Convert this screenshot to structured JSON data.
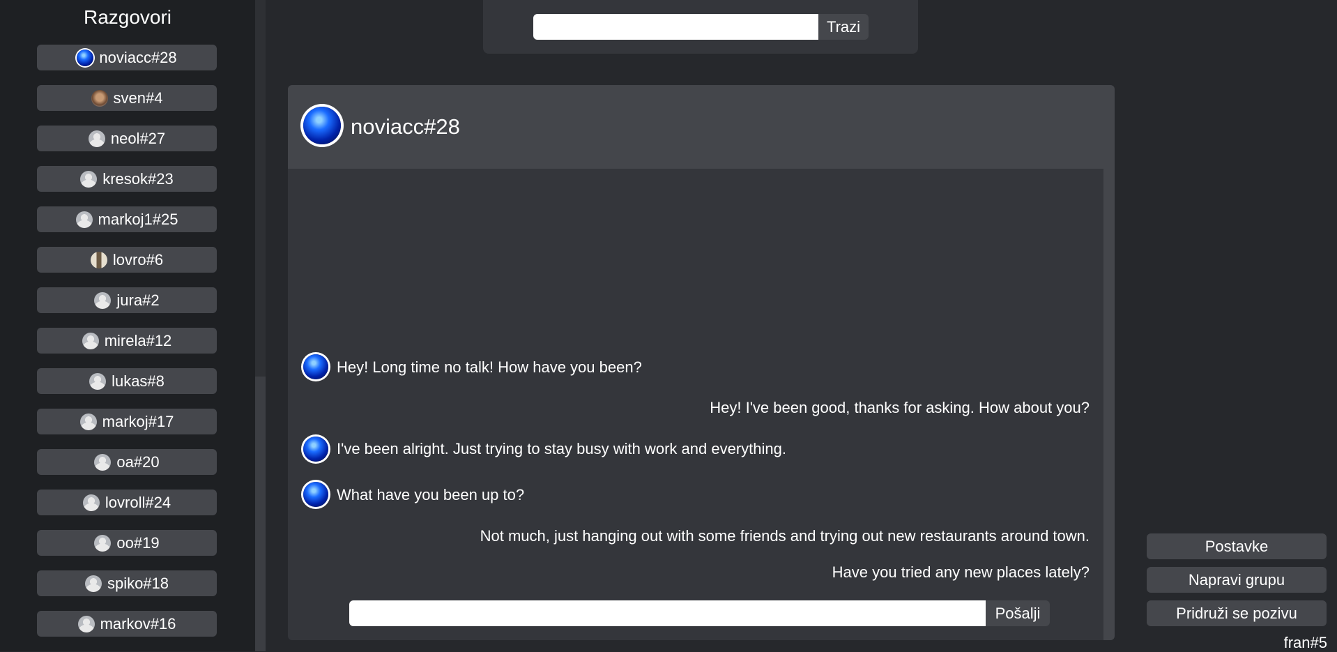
{
  "sidebar": {
    "title": "Razgovori",
    "conversations": [
      {
        "name": "noviacc#28",
        "avatar": "blue-orb-avatar"
      },
      {
        "name": "sven#4",
        "avatar": "photo-avatar"
      },
      {
        "name": "neol#27",
        "avatar": "default-user-icon"
      },
      {
        "name": "kresok#23",
        "avatar": "default-user-icon"
      },
      {
        "name": "markoj1#25",
        "avatar": "default-user-icon"
      },
      {
        "name": "lovro#6",
        "avatar": "photo-avatar"
      },
      {
        "name": "jura#2",
        "avatar": "default-user-icon"
      },
      {
        "name": "mirela#12",
        "avatar": "default-user-icon"
      },
      {
        "name": "lukas#8",
        "avatar": "default-user-icon"
      },
      {
        "name": "markoj#17",
        "avatar": "default-user-icon"
      },
      {
        "name": "oa#20",
        "avatar": "default-user-icon"
      },
      {
        "name": "lovroll#24",
        "avatar": "default-user-icon"
      },
      {
        "name": "oo#19",
        "avatar": "default-user-icon"
      },
      {
        "name": "spiko#18",
        "avatar": "default-user-icon"
      },
      {
        "name": "markov#16",
        "avatar": "default-user-icon"
      }
    ]
  },
  "search": {
    "value": "",
    "button_label": "Trazi"
  },
  "chat": {
    "contact_name": "noviacc#28",
    "messages": [
      {
        "text": "Hey! Long time no talk! How have you been?",
        "side": "left"
      },
      {
        "text": "Hey! I've been good, thanks for asking. How about you?",
        "side": "right"
      },
      {
        "text": "I've been alright. Just trying to stay busy with work and everything.",
        "side": "left"
      },
      {
        "text": "What have you been up to?",
        "side": "left"
      },
      {
        "text": "Not much, just hanging out with some friends and trying out new restaurants around town.",
        "side": "right"
      },
      {
        "text": "Have you tried any new places lately?",
        "side": "right"
      }
    ],
    "composer_value": "",
    "send_label": "Pošalji"
  },
  "actions": {
    "settings_label": "Postavke",
    "create_group_label": "Napravi grupu",
    "join_invite_label": "Pridruži se pozivu"
  },
  "current_user": "fran#5",
  "colors": {
    "background": "#26282c",
    "sidebar": "#1e2023",
    "panel": "#34363b",
    "button": "#45474c",
    "text": "#ffffff"
  }
}
